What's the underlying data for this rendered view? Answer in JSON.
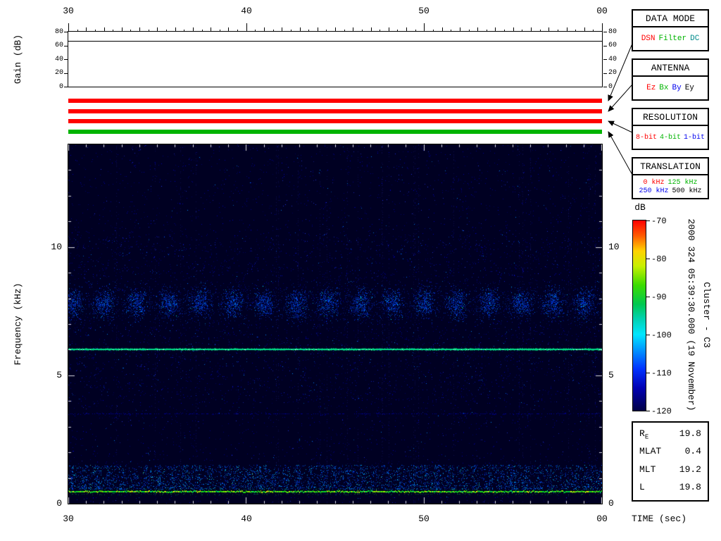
{
  "labels": {
    "gain_ylabel": "Gain (dB)",
    "freq_ylabel": "Frequency (kHz)",
    "time_xlabel": "TIME (sec)",
    "colorbar_label": "dB"
  },
  "time_axis": {
    "ticks": [
      "30",
      "40",
      "50",
      "00"
    ],
    "values": [
      30,
      40,
      50,
      60
    ]
  },
  "gain_panel": {
    "yticks": [
      "0",
      "20",
      "40",
      "60",
      "80"
    ],
    "ytick_values": [
      0,
      20,
      40,
      60,
      80
    ]
  },
  "freq_axis": {
    "yticks": [
      "0",
      "5",
      "10"
    ]
  },
  "status_bars": [
    {
      "name": "data-mode",
      "color": "#ff0000"
    },
    {
      "name": "antenna",
      "color": "#ff0000"
    },
    {
      "name": "resolution",
      "color": "#ff0000"
    },
    {
      "name": "translation",
      "color": "#00b400"
    }
  ],
  "legend_boxes": [
    {
      "title": "DATA MODE",
      "items": [
        {
          "label": "DSN",
          "color": "#ff0000"
        },
        {
          "label": "Filter",
          "color": "#00b400"
        },
        {
          "label": "DC",
          "color": "#008b8b"
        }
      ]
    },
    {
      "title": "ANTENNA",
      "items": [
        {
          "label": "Ez",
          "color": "#ff0000"
        },
        {
          "label": "Bx",
          "color": "#00b400"
        },
        {
          "label": "By",
          "color": "#0000ee"
        },
        {
          "label": "Ey",
          "color": "#000000"
        }
      ]
    },
    {
      "title": "RESOLUTION",
      "items": [
        {
          "label": "8-bit",
          "color": "#ff0000"
        },
        {
          "label": "4-bit",
          "color": "#00b400"
        },
        {
          "label": "1-bit",
          "color": "#0000ee"
        }
      ]
    },
    {
      "title": "TRANSLATION",
      "items": [
        {
          "label": "0 kHz",
          "color": "#ff0000"
        },
        {
          "label": "125 kHz",
          "color": "#00b400"
        },
        {
          "label": "250 kHz",
          "color": "#0000ee"
        },
        {
          "label": "500 kHz",
          "color": "#000000"
        }
      ]
    }
  ],
  "colorbar": {
    "label": "dB",
    "ticks": [
      "-70",
      "-80",
      "-90",
      "-100",
      "-110",
      "-120"
    ],
    "gradient": [
      {
        "at": 0.0,
        "color": "#ff0000"
      },
      {
        "at": 0.08,
        "color": "#ff5a00"
      },
      {
        "at": 0.16,
        "color": "#ffd200"
      },
      {
        "at": 0.24,
        "color": "#c8f000"
      },
      {
        "at": 0.34,
        "color": "#3cdc00"
      },
      {
        "at": 0.44,
        "color": "#00c850"
      },
      {
        "at": 0.52,
        "color": "#00d2b4"
      },
      {
        "at": 0.6,
        "color": "#00e6ff"
      },
      {
        "at": 0.68,
        "color": "#0096ff"
      },
      {
        "at": 0.78,
        "color": "#0032ff"
      },
      {
        "at": 0.88,
        "color": "#0000b4"
      },
      {
        "at": 1.0,
        "color": "#000046"
      }
    ]
  },
  "side_text": {
    "datetime": "2000 324 05:39:30.000 (19 November)",
    "spacecraft": "Cluster - C3"
  },
  "ephemeris": {
    "rows": [
      {
        "label": "R",
        "sublabel": "E",
        "value": "19.8"
      },
      {
        "label": "MLAT",
        "sublabel": "",
        "value": "0.4"
      },
      {
        "label": "MLT",
        "sublabel": "",
        "value": "19.2"
      },
      {
        "label": "L",
        "sublabel": "",
        "value": "19.8"
      }
    ]
  },
  "chart_data": [
    {
      "type": "line",
      "title": "Receiver gain",
      "ylabel": "Gain (dB)",
      "xlabel": "TIME (sec)",
      "x": [
        30,
        60
      ],
      "values": [
        67,
        67
      ],
      "ylim": [
        0,
        80
      ],
      "xlim": [
        30,
        60
      ],
      "xticks": [
        30,
        40,
        50,
        60
      ],
      "yticks": [
        0,
        20,
        40,
        60,
        80
      ]
    },
    {
      "type": "heatmap",
      "title": "Cluster C3 WBD spectrogram 2000 324 05:39:30.000 (19 November)",
      "xlabel": "TIME (sec)",
      "ylabel": "Frequency (kHz)",
      "xlim": [
        30,
        60
      ],
      "ylim": [
        0,
        14
      ],
      "xticks": [
        30,
        40,
        50,
        60
      ],
      "yticks": [
        0,
        5,
        10
      ],
      "zlabel": "dB",
      "zlim": [
        -120,
        -70
      ],
      "legend_position": "right",
      "features": {
        "background_db": -120,
        "narrowband_tone": {
          "freq_khz": 6.0,
          "db": -85
        },
        "periodic_blobs": {
          "center_khz": 7.8,
          "sigma_khz": 0.38,
          "period_sec": 1.8,
          "db": -108
        },
        "striated_band": {
          "low_khz": 0.55,
          "high_khz": 1.5,
          "db": -105
        },
        "intense_line": {
          "freq_khz": 0.45,
          "db": -82
        },
        "faint_line": {
          "freq_khz": 3.5,
          "db": -114
        }
      }
    }
  ]
}
